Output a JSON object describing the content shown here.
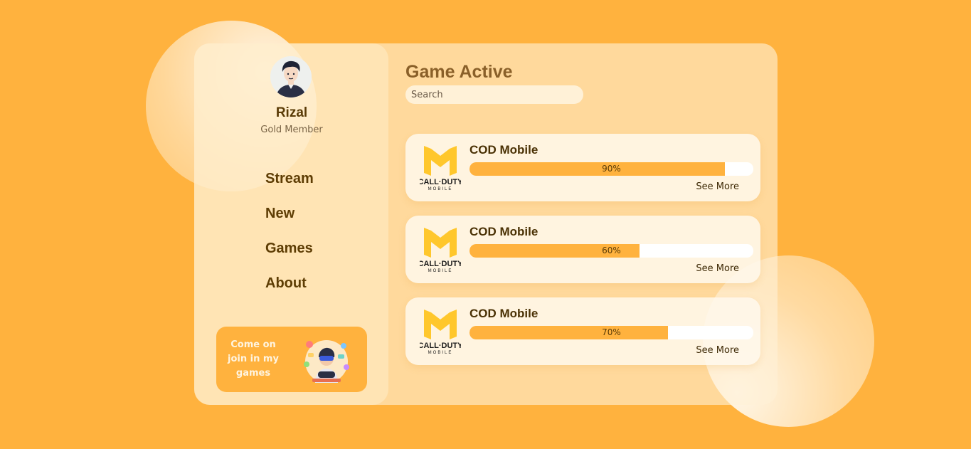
{
  "profile": {
    "name": "Rizal",
    "tier": "Gold Member"
  },
  "nav": [
    {
      "label": "Stream"
    },
    {
      "label": "New"
    },
    {
      "label": "Games"
    },
    {
      "label": "About"
    }
  ],
  "promo": {
    "text": "Come on join in my games"
  },
  "main": {
    "title": "Game Active",
    "search_placeholder": "Search"
  },
  "games": [
    {
      "name": "COD Mobile",
      "progress": 90,
      "progress_label": "90%",
      "action": "See More",
      "logo_text_1": "CALL·DUTY",
      "logo_text_2": "MOBILE"
    },
    {
      "name": "COD Mobile",
      "progress": 60,
      "progress_label": "60%",
      "action": "See More",
      "logo_text_1": "CALL·DUTY",
      "logo_text_2": "MOBILE"
    },
    {
      "name": "COD Mobile",
      "progress": 70,
      "progress_label": "70%",
      "action": "See More",
      "logo_text_1": "CALL·DUTY",
      "logo_text_2": "MOBILE"
    }
  ],
  "colors": {
    "background": "#ffb23e",
    "accent": "#ffb23e",
    "text_dark": "#5a3b06"
  }
}
